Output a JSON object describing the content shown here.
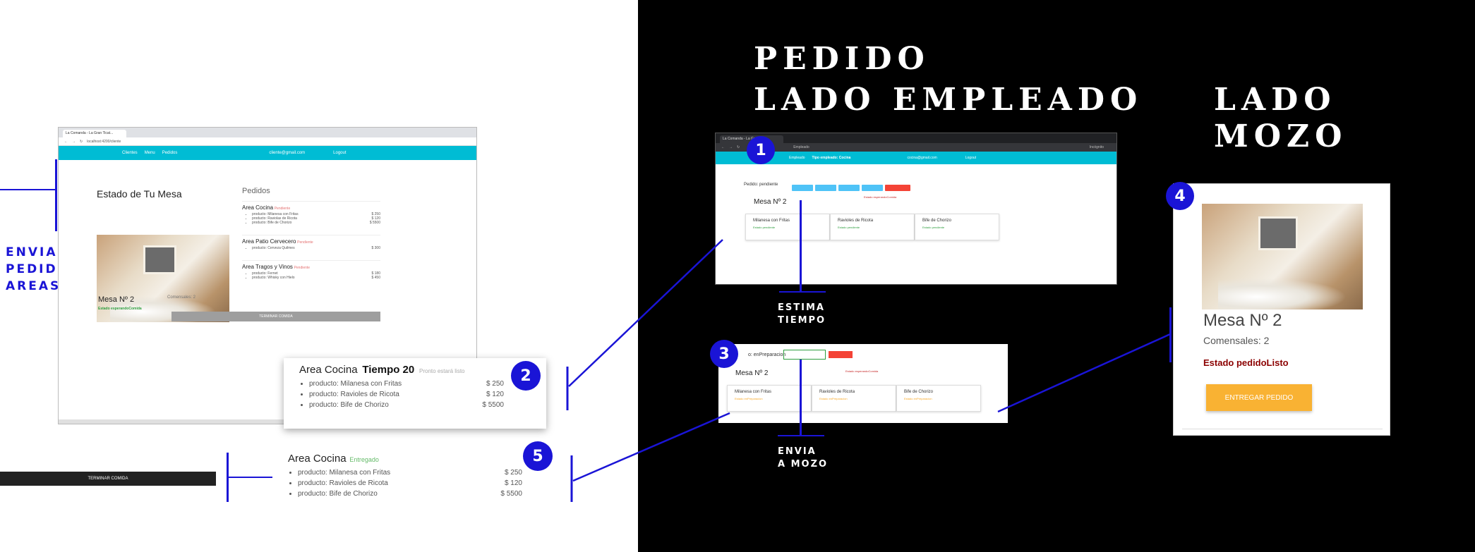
{
  "headings": {
    "pedido": "PEDIDO",
    "lado_empleado": "LADO EMPLEADO",
    "lado_mozo": "LADO MOZO"
  },
  "labels": {
    "envia_pedido_areas": [
      "ENVIA",
      "PEDIDO",
      "AREAS"
    ],
    "estima_tiempo": [
      "ESTIMA",
      "TIEMPO"
    ],
    "envia_a_mozo": [
      "ENVIA",
      "A MOZO"
    ]
  },
  "steps": [
    "1",
    "2",
    "3",
    "4",
    "5"
  ],
  "client_view": {
    "tab_title": "La Comanda - La Gran Ticat...",
    "address": "localhost:4200/cliente",
    "nav": [
      "Clientes",
      "Menu",
      "Pedidos"
    ],
    "user_email": "cliente@gmail.com",
    "logout": "Logout",
    "title": "Estado de Tu Mesa",
    "mesa": "Mesa Nº 2",
    "comensales": "Comensales: 2",
    "estado": "Estado esperandoComida",
    "terminar_button": "TERMINAR COMIDA",
    "pedidos_title": "Pedidos",
    "areas": [
      {
        "name": "Area Cocina",
        "status": "Pendiente",
        "items": [
          {
            "name": "producto: Milanesa con Fritas",
            "price": "$ 250"
          },
          {
            "name": "producto: Raviolas de Ricota",
            "price": "$ 120"
          },
          {
            "name": "producto: Bife de Chorizo",
            "price": "$ 5500"
          }
        ]
      },
      {
        "name": "Area Patio Cervecero",
        "status": "Pendiente",
        "items": [
          {
            "name": "producto: Cerveza Quilmes",
            "price": "$ 300"
          }
        ]
      },
      {
        "name": "Area Tragos y Vinos",
        "status": "Pendiente",
        "items": [
          {
            "name": "producto: Fernet",
            "price": "$ 180"
          },
          {
            "name": "producto: Whisky con Hielo",
            "price": "$ 450"
          }
        ]
      }
    ]
  },
  "zoom_tiempo": {
    "area": "Area Cocina",
    "tiempo": "Tiempo 20",
    "status": "Pronto estará listo",
    "items": [
      {
        "name": "producto: Milanesa con Fritas",
        "price": "$ 250"
      },
      {
        "name": "producto: Ravioles de Ricota",
        "price": "$ 120"
      },
      {
        "name": "producto: Bife de Chorizo",
        "price": "$ 5500"
      }
    ]
  },
  "zoom_entregado": {
    "area": "Area Cocina",
    "status": "Entregado",
    "items": [
      {
        "name": "producto: Milanesa con Fritas",
        "price": "$ 250"
      },
      {
        "name": "producto: Ravioles de Ricota",
        "price": "$ 120"
      },
      {
        "name": "producto: Bife de Chorizo",
        "price": "$ 5500"
      }
    ]
  },
  "terminar_bar": "TERMINAR COMIDA",
  "employee_view": {
    "tab_title": "La Comanda - La Gran...",
    "address": "Empleado",
    "incognito": "Incógnito",
    "nav": [
      "Empleado",
      "Tipo empleado: Cocina"
    ],
    "user_email": "cocina@gmail.com",
    "logout": "Logout",
    "pedido_label": "Pedido: pendiente",
    "mesa": "Mesa Nº 2",
    "estado": "Estado esperandoComida",
    "cards": [
      {
        "name": "Milanesa con Fritas",
        "status": "Estado pendiente"
      },
      {
        "name": "Ravioles de Ricota",
        "status": "Estado pendiente"
      },
      {
        "name": "Bife de Chorizo",
        "status": "Estado pendiente"
      }
    ]
  },
  "prep_view": {
    "pedido_label": "o: enPreparacion",
    "mesa": "Mesa Nº 2",
    "estado": "Estado esperandoComida",
    "cards": [
      {
        "name": "Milanesa con Fritas",
        "status": "Estado enPreparacion"
      },
      {
        "name": "Ravioles de Ricota",
        "status": "Estado enPreparacion"
      },
      {
        "name": "Bife de Chorizo",
        "status": "Estado enPreparacion"
      }
    ]
  },
  "mozo_view": {
    "mesa": "Mesa Nº 2",
    "comensales": "Comensales: 2",
    "estado": "Estado pedidoListo",
    "button": "ENTREGAR PEDIDO"
  },
  "colors": {
    "accent_blue": "#1a14d6",
    "navbar": "#00bcd4",
    "estado_green": "#2e9e3e",
    "estado_red": "#8b0000",
    "orange_button": "#f9b233"
  }
}
